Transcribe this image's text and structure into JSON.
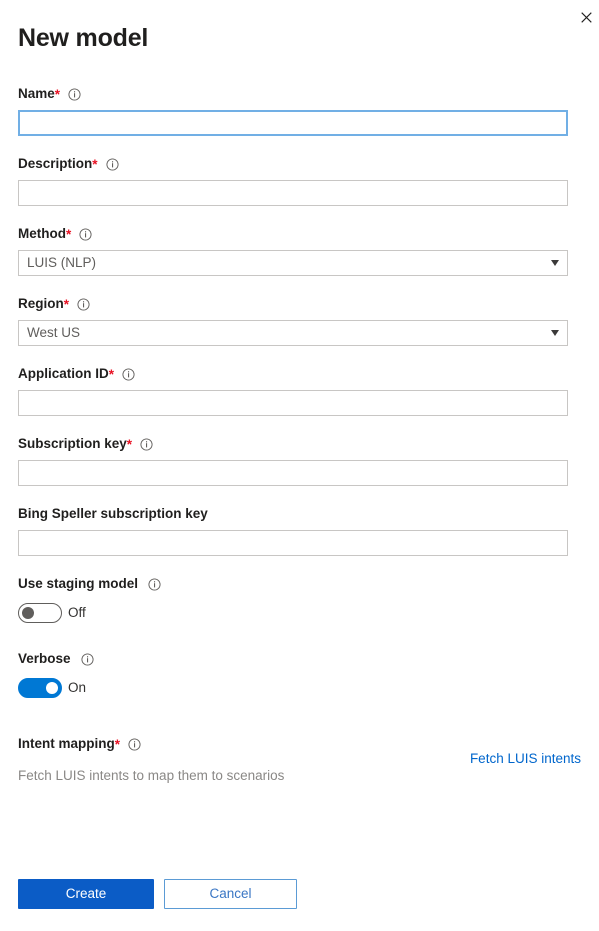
{
  "panel": {
    "title": "New model",
    "close_icon": "close-icon"
  },
  "fields": {
    "name": {
      "label": "Name",
      "required_marker": "*",
      "info_icon": "info-icon",
      "value": "",
      "placeholder": ""
    },
    "description": {
      "label": "Description",
      "required_marker": "*",
      "info_icon": "info-icon",
      "value": "",
      "placeholder": ""
    },
    "method": {
      "label": "Method",
      "required_marker": "*",
      "info_icon": "info-icon",
      "selected": "LUIS (NLP)",
      "caret_icon": "chevron-down-icon"
    },
    "region": {
      "label": "Region",
      "required_marker": "*",
      "info_icon": "info-icon",
      "selected": "West US",
      "caret_icon": "chevron-down-icon"
    },
    "application_id": {
      "label": "Application ID",
      "required_marker": "*",
      "info_icon": "info-icon",
      "value": "",
      "placeholder": ""
    },
    "subscription_key": {
      "label": "Subscription key",
      "required_marker": "*",
      "info_icon": "info-icon",
      "value": "",
      "placeholder": ""
    },
    "bing_speller_key": {
      "label": "Bing Speller subscription key",
      "value": "",
      "placeholder": ""
    },
    "use_staging_model": {
      "label": "Use staging model",
      "info_icon": "info-icon",
      "state": "Off",
      "on": false
    },
    "verbose": {
      "label": "Verbose",
      "info_icon": "info-icon",
      "state": "On",
      "on": true
    },
    "intent_mapping": {
      "label": "Intent mapping",
      "required_marker": "*",
      "info_icon": "info-icon",
      "hint": "Fetch LUIS intents to map them to scenarios",
      "fetch_link": "Fetch LUIS intents"
    }
  },
  "footer": {
    "create_label": "Create",
    "cancel_label": "Cancel"
  },
  "colors": {
    "accent": "#0078d4",
    "primary_button": "#0b5cc6",
    "link": "#0066cc",
    "required": "#e81123",
    "border": "#c8c6c4",
    "focus_border": "#71afe5",
    "hint_text": "#8a8886"
  }
}
